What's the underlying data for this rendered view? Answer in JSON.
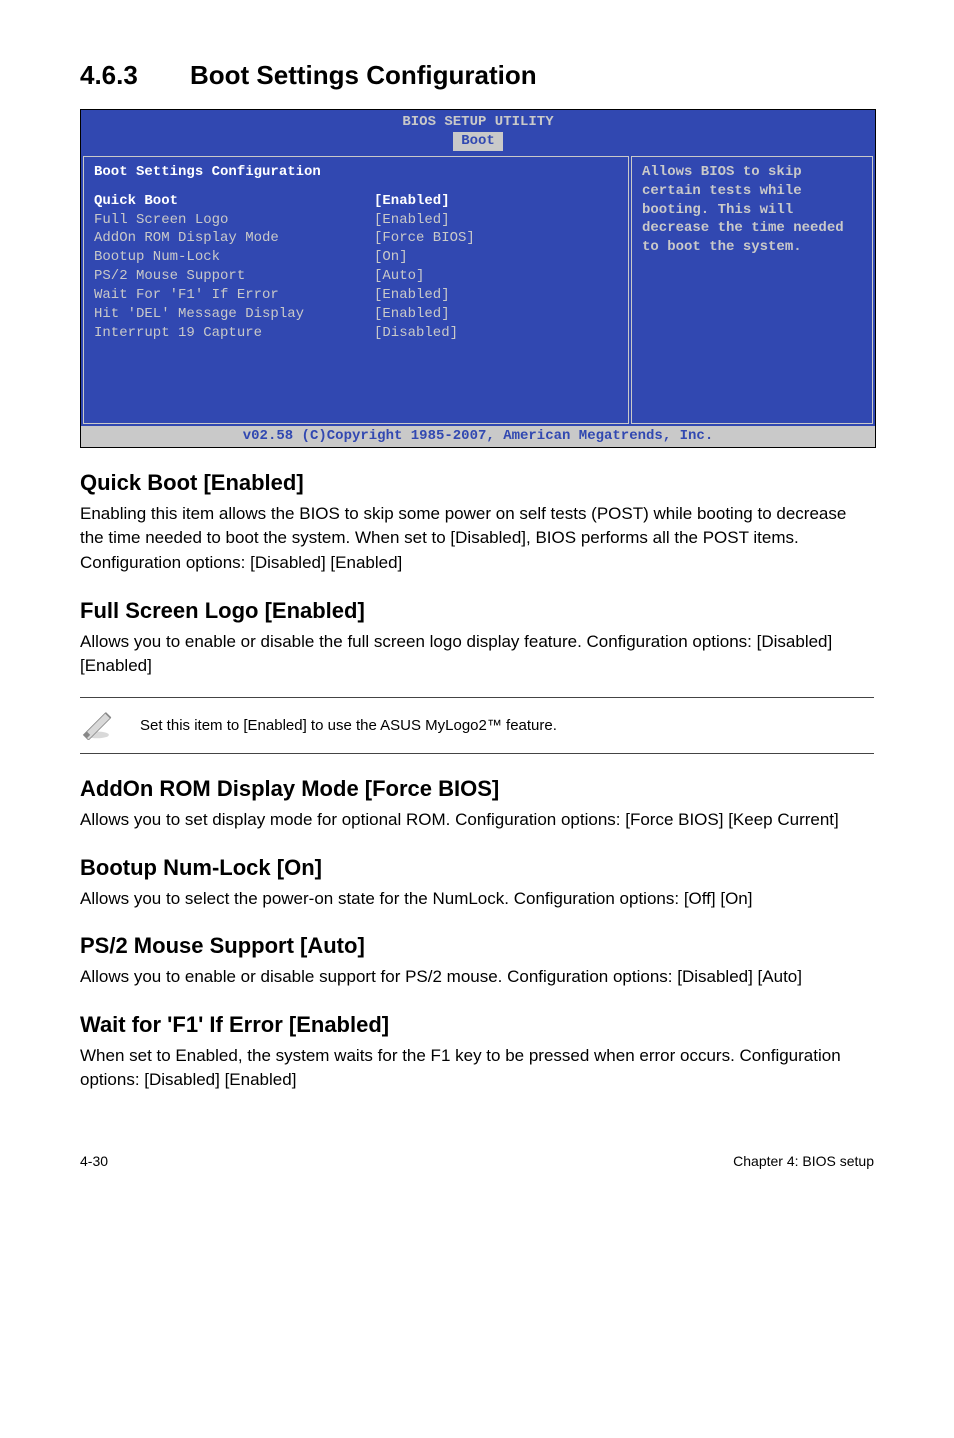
{
  "section_number": "4.6.3",
  "section_title": "Boot Settings Configuration",
  "bios": {
    "header_title": "BIOS SETUP UTILITY",
    "tab": "Boot",
    "panel_title": "Boot Settings Configuration",
    "rows": [
      {
        "label": "Quick Boot",
        "value": "[Enabled]",
        "selected": true
      },
      {
        "label": "Full Screen Logo",
        "value": "[Enabled]",
        "selected": false
      },
      {
        "label": "AddOn ROM Display Mode",
        "value": "[Force BIOS]",
        "selected": false
      },
      {
        "label": "Bootup Num-Lock",
        "value": "[On]",
        "selected": false
      },
      {
        "label": "PS/2 Mouse Support",
        "value": "[Auto]",
        "selected": false
      },
      {
        "label": "Wait For 'F1' If Error",
        "value": "[Enabled]",
        "selected": false
      },
      {
        "label": "Hit 'DEL' Message Display",
        "value": "[Enabled]",
        "selected": false
      },
      {
        "label": "Interrupt 19 Capture",
        "value": "[Disabled]",
        "selected": false
      }
    ],
    "help_text": "Allows BIOS to skip certain tests while booting. This will decrease the time needed to boot the system.",
    "footer": "v02.58 (C)Copyright 1985-2007, American Megatrends, Inc."
  },
  "subsections": [
    {
      "heading": "Quick Boot [Enabled]",
      "body": "Enabling this item allows the BIOS to skip some power on self tests (POST) while booting to decrease the time needed to boot the system. When set to [Disabled], BIOS performs all the POST items. Configuration options: [Disabled] [Enabled]"
    },
    {
      "heading": "Full Screen Logo [Enabled]",
      "body": "Allows you to enable or disable the full screen logo display feature. Configuration options: [Disabled] [Enabled]"
    }
  ],
  "note_text": "Set this item to [Enabled] to use the ASUS MyLogo2™ feature.",
  "subsections2": [
    {
      "heading": "AddOn ROM Display Mode [Force BIOS]",
      "body": "Allows you to set display mode for optional ROM. Configuration options: [Force BIOS] [Keep Current]"
    },
    {
      "heading": "Bootup Num-Lock [On]",
      "body": "Allows you to select the power-on state for the NumLock. Configuration options: [Off] [On]"
    },
    {
      "heading": "PS/2 Mouse Support [Auto]",
      "body": "Allows you to enable or disable support for PS/2 mouse. Configuration options: [Disabled] [Auto]"
    },
    {
      "heading": "Wait for 'F1' If Error [Enabled]",
      "body": "When set to Enabled, the system waits for the F1 key to be pressed when error occurs. Configuration options: [Disabled] [Enabled]"
    }
  ],
  "footer_left": "4-30",
  "footer_right": "Chapter 4: BIOS setup"
}
